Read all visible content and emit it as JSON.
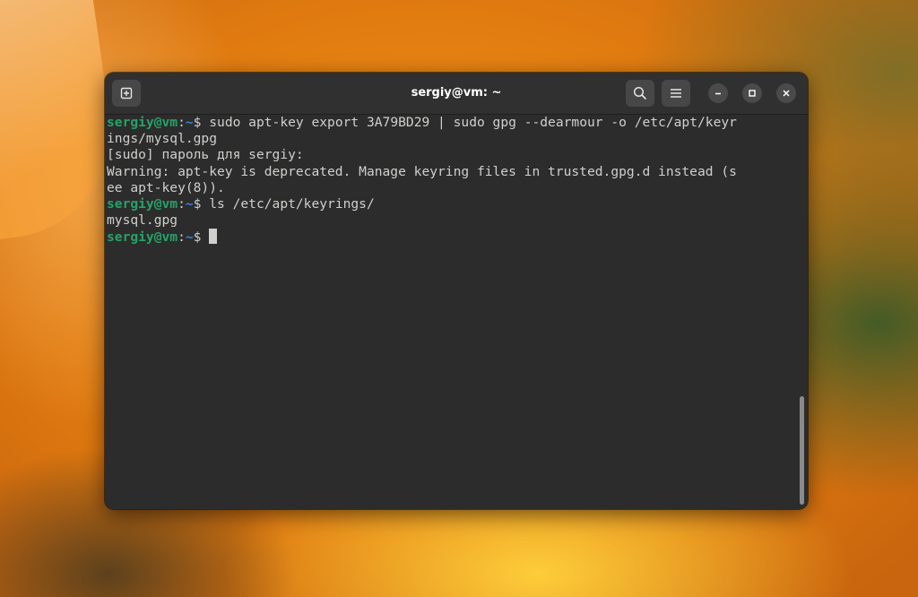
{
  "window": {
    "title": "sergiy@vm: ~"
  },
  "titlebar": {
    "icons": [
      "new-tab-icon",
      "search-icon",
      "hamburger-menu-icon",
      "minimize-icon",
      "maximize-icon",
      "close-icon"
    ]
  },
  "terminal": {
    "prompt_user": "sergiy@vm",
    "prompt_sep": ":",
    "prompt_path": "~",
    "prompt_symbol": "$ ",
    "lines": [
      {
        "type": "prompt",
        "command": "sudo apt-key export 3A79BD29 | sudo gpg --dearmour -o /etc/apt/keyr"
      },
      {
        "type": "output",
        "text": "ings/mysql.gpg"
      },
      {
        "type": "output",
        "text": "[sudo] пароль для sergiy:"
      },
      {
        "type": "output",
        "text": "Warning: apt-key is deprecated. Manage keyring files in trusted.gpg.d instead (s"
      },
      {
        "type": "output",
        "text": "ee apt-key(8))."
      },
      {
        "type": "prompt",
        "command": "ls /etc/apt/keyrings/"
      },
      {
        "type": "output",
        "text": "mysql.gpg"
      },
      {
        "type": "prompt",
        "command": ""
      }
    ]
  },
  "colors": {
    "terminal_bg": "#2c2c2c",
    "prompt_user": "#26a269",
    "prompt_path": "#3584e4",
    "text": "#d0cfcc"
  }
}
